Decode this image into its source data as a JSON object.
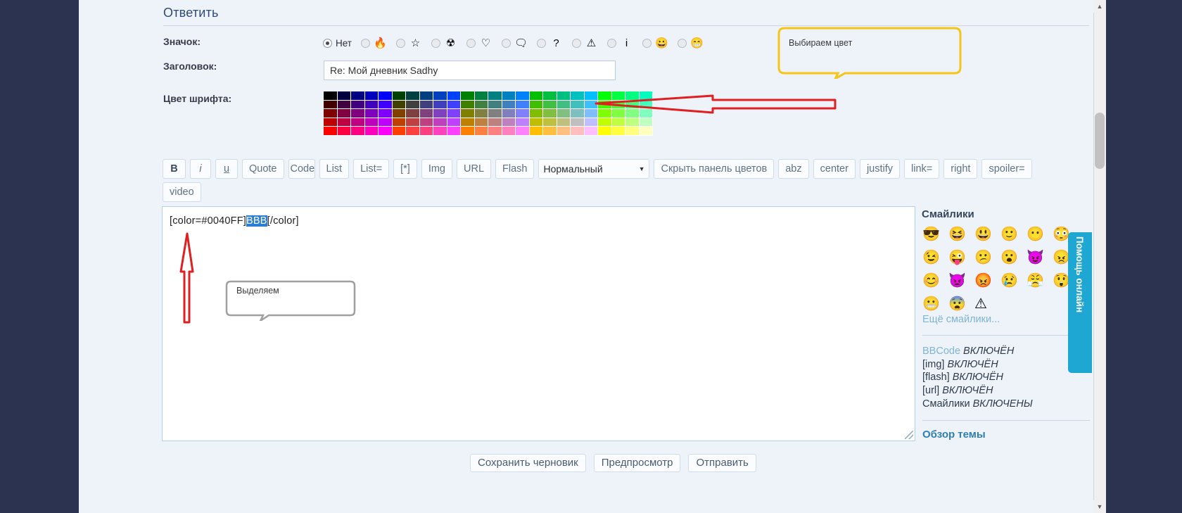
{
  "header": {
    "reply_title": "Ответить"
  },
  "labels": {
    "icon": "Значок:",
    "subject": "Заголовок:",
    "font_color": "Цвет шрифта:"
  },
  "icon_row": {
    "none_label": "Нет",
    "options": [
      {
        "name": "none",
        "glyph": ""
      },
      {
        "name": "fire-icon",
        "glyph": "🔥"
      },
      {
        "name": "star-icon",
        "glyph": "☆"
      },
      {
        "name": "radioactive-icon",
        "glyph": "☢"
      },
      {
        "name": "heart-icon",
        "glyph": "♡"
      },
      {
        "name": "thought-bubble-icon",
        "glyph": "🗨"
      },
      {
        "name": "question-icon",
        "glyph": "?"
      },
      {
        "name": "warning-icon",
        "glyph": "⚠"
      },
      {
        "name": "info-icon",
        "glyph": "i"
      },
      {
        "name": "smiley-orange-icon",
        "glyph": "😀"
      },
      {
        "name": "smiley-green-icon",
        "glyph": "😁"
      }
    ],
    "selected_index": 0
  },
  "subject": {
    "value": "Re: Мой дневник Sadhy",
    "placeholder": ""
  },
  "palette": {
    "columns": 24,
    "rows": 5,
    "colors": [
      "#000000",
      "#000040",
      "#000080",
      "#0000BF",
      "#0000FF",
      "#004000",
      "#004040",
      "#004080",
      "#0040BF",
      "#0040FF",
      "#008000",
      "#008040",
      "#008080",
      "#0080BF",
      "#0080FF",
      "#00BF00",
      "#00BF40",
      "#00BF80",
      "#00BFBF",
      "#00BFFF",
      "#00FF00",
      "#00FF40",
      "#00FF80",
      "#00FFBF",
      "#400000",
      "#400040",
      "#400080",
      "#4000BF",
      "#4000FF",
      "#404000",
      "#404040",
      "#404080",
      "#4040BF",
      "#4040FF",
      "#408000",
      "#408040",
      "#408080",
      "#4080BF",
      "#4080FF",
      "#40BF00",
      "#40BF40",
      "#40BF80",
      "#40BFBF",
      "#40BFFF",
      "#40FF00",
      "#40FF40",
      "#40FF80",
      "#40FFBF",
      "#800000",
      "#800040",
      "#800080",
      "#8000BF",
      "#8000FF",
      "#804000",
      "#804040",
      "#804080",
      "#8040BF",
      "#8040FF",
      "#808000",
      "#808040",
      "#808080",
      "#8080BF",
      "#8080FF",
      "#80BF00",
      "#80BF40",
      "#80BF80",
      "#80BFBF",
      "#80BFFF",
      "#80FF00",
      "#80FF40",
      "#80FF80",
      "#80FFBF",
      "#BF0000",
      "#BF0040",
      "#BF0080",
      "#BF00BF",
      "#BF00FF",
      "#BF4000",
      "#BF4040",
      "#BF4080",
      "#BF40BF",
      "#BF40FF",
      "#BF8000",
      "#BF8040",
      "#BF8080",
      "#BF80BF",
      "#BF80FF",
      "#BFBF00",
      "#BFBF40",
      "#BFBF80",
      "#BFBFBF",
      "#BFBFFF",
      "#BFFF00",
      "#BFFF40",
      "#BFFF80",
      "#BFFFBF",
      "#FF0000",
      "#FF0040",
      "#FF0080",
      "#FF00BF",
      "#FF00FF",
      "#FF4000",
      "#FF4040",
      "#FF4080",
      "#FF40BF",
      "#FF40FF",
      "#FF8000",
      "#FF8040",
      "#FF8080",
      "#FF80BF",
      "#FF80FF",
      "#FFBF00",
      "#FFBF40",
      "#FFBF80",
      "#FFBFBF",
      "#FFBFFF",
      "#FFFF00",
      "#FFFF40",
      "#FFFF80",
      "#FFFFBF"
    ]
  },
  "toolbar": {
    "buttons": [
      {
        "name": "bold-button",
        "label": "B",
        "style": "b"
      },
      {
        "name": "italic-button",
        "label": "i",
        "style": "i"
      },
      {
        "name": "underline-button",
        "label": "u",
        "style": "u"
      },
      {
        "name": "quote-button",
        "label": "Quote",
        "style": ""
      },
      {
        "name": "code-button",
        "label": "Code",
        "style": "code"
      },
      {
        "name": "list-button",
        "label": "List",
        "style": ""
      },
      {
        "name": "list-eq-button",
        "label": "List=",
        "style": ""
      },
      {
        "name": "list-item-button",
        "label": "[*]",
        "style": ""
      },
      {
        "name": "img-button",
        "label": "Img",
        "style": ""
      },
      {
        "name": "url-button",
        "label": "URL",
        "style": ""
      },
      {
        "name": "flash-button",
        "label": "Flash",
        "style": ""
      }
    ],
    "font_size_selected": "Нормальный",
    "buttons_after": [
      {
        "name": "hide-color-panel-button",
        "label": "Скрыть панель цветов"
      },
      {
        "name": "abz-button",
        "label": "abz"
      },
      {
        "name": "center-button",
        "label": "center"
      },
      {
        "name": "justify-button",
        "label": "justify"
      },
      {
        "name": "link-eq-button",
        "label": "link="
      },
      {
        "name": "right-button",
        "label": "right"
      },
      {
        "name": "spoiler-eq-button",
        "label": "spoiler="
      },
      {
        "name": "video-button",
        "label": "video"
      }
    ]
  },
  "message": {
    "before": "[color=#0040FF]",
    "selected": "BBB",
    "after": "[/color]"
  },
  "right_panel": {
    "smilies_title": "Смайлики",
    "smilies": [
      "😎",
      "😆",
      "😃",
      "🙂",
      "😶",
      "😳",
      "😉",
      "😜",
      "😕",
      "😮",
      "😈",
      "😠",
      "😊",
      "👿",
      "😡",
      "😢",
      "😤",
      "😲",
      "😬",
      "😨",
      "⚠"
    ],
    "more_smilies": "Ещё смайлики...",
    "bbcode_info": [
      {
        "key": "BBCode",
        "value": "ВКЛЮЧЁН",
        "link": true
      },
      {
        "key": "[img]",
        "value": "ВКЛЮЧЁН",
        "link": false
      },
      {
        "key": "[flash]",
        "value": "ВКЛЮЧЁН",
        "link": false
      },
      {
        "key": "[url]",
        "value": "ВКЛЮЧЁН",
        "link": false
      },
      {
        "key": "Смайлики",
        "value": "ВКЛЮЧЕНЫ",
        "link": false
      }
    ],
    "topic_review": "Обзор темы"
  },
  "footer": {
    "save_draft": "Сохранить черновик",
    "preview": "Предпросмотр",
    "submit": "Отправить"
  },
  "help_tab": {
    "label": "Помощь онлайн"
  },
  "annotations": {
    "color_callout": "Выбираем цвет",
    "select_callout": "Выделяем",
    "callout_border_color": "#F5C518",
    "callout_border_color_2": "#A0A0A0",
    "arrow_color": "#E02020"
  },
  "scrollbar": {
    "up_glyph": "▲",
    "down_glyph": "▼"
  }
}
